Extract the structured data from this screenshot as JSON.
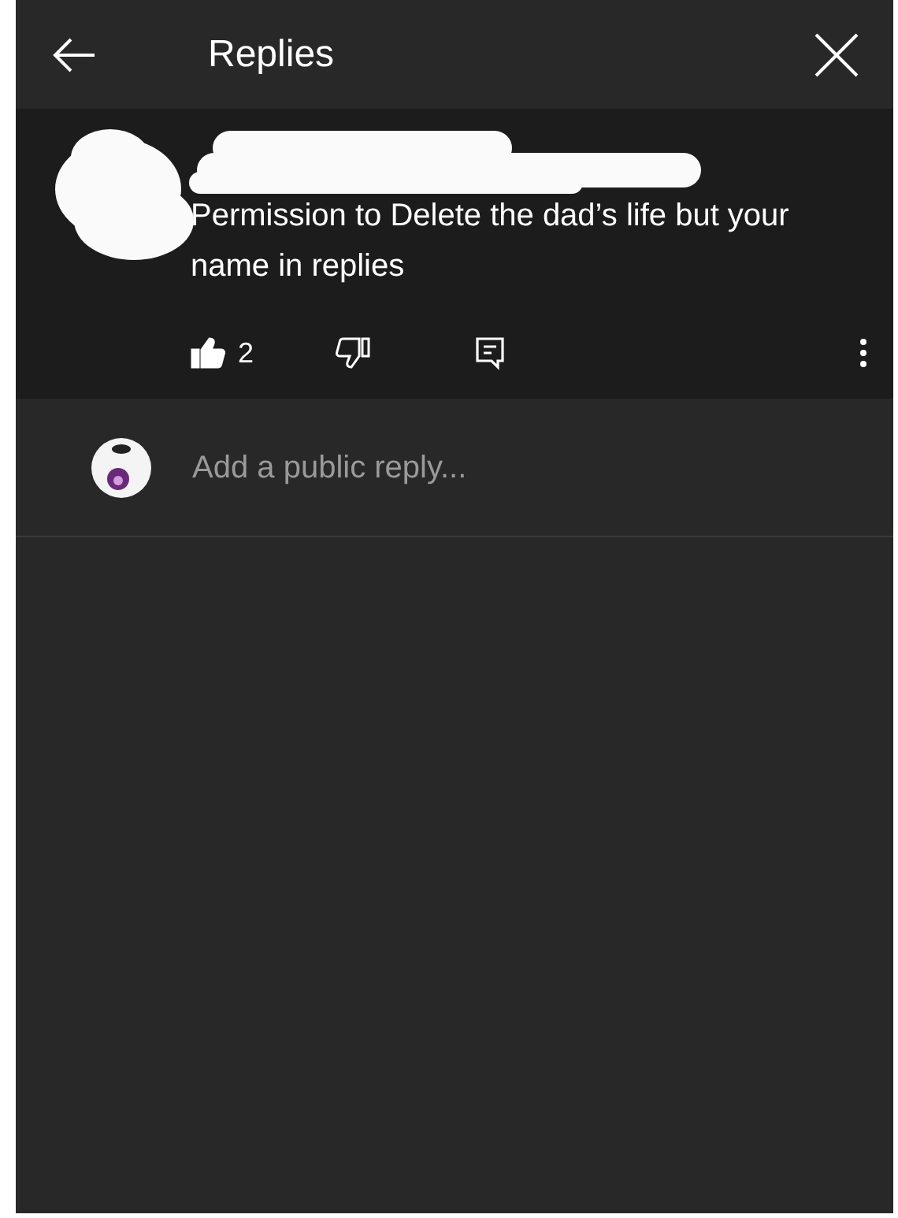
{
  "header": {
    "title": "Replies"
  },
  "comment": {
    "text": "Permission to Delete the dad’s life but your name in replies",
    "likes": "2",
    "liked": true,
    "disliked": false
  },
  "reply_field": {
    "placeholder": "Add a public reply..."
  }
}
